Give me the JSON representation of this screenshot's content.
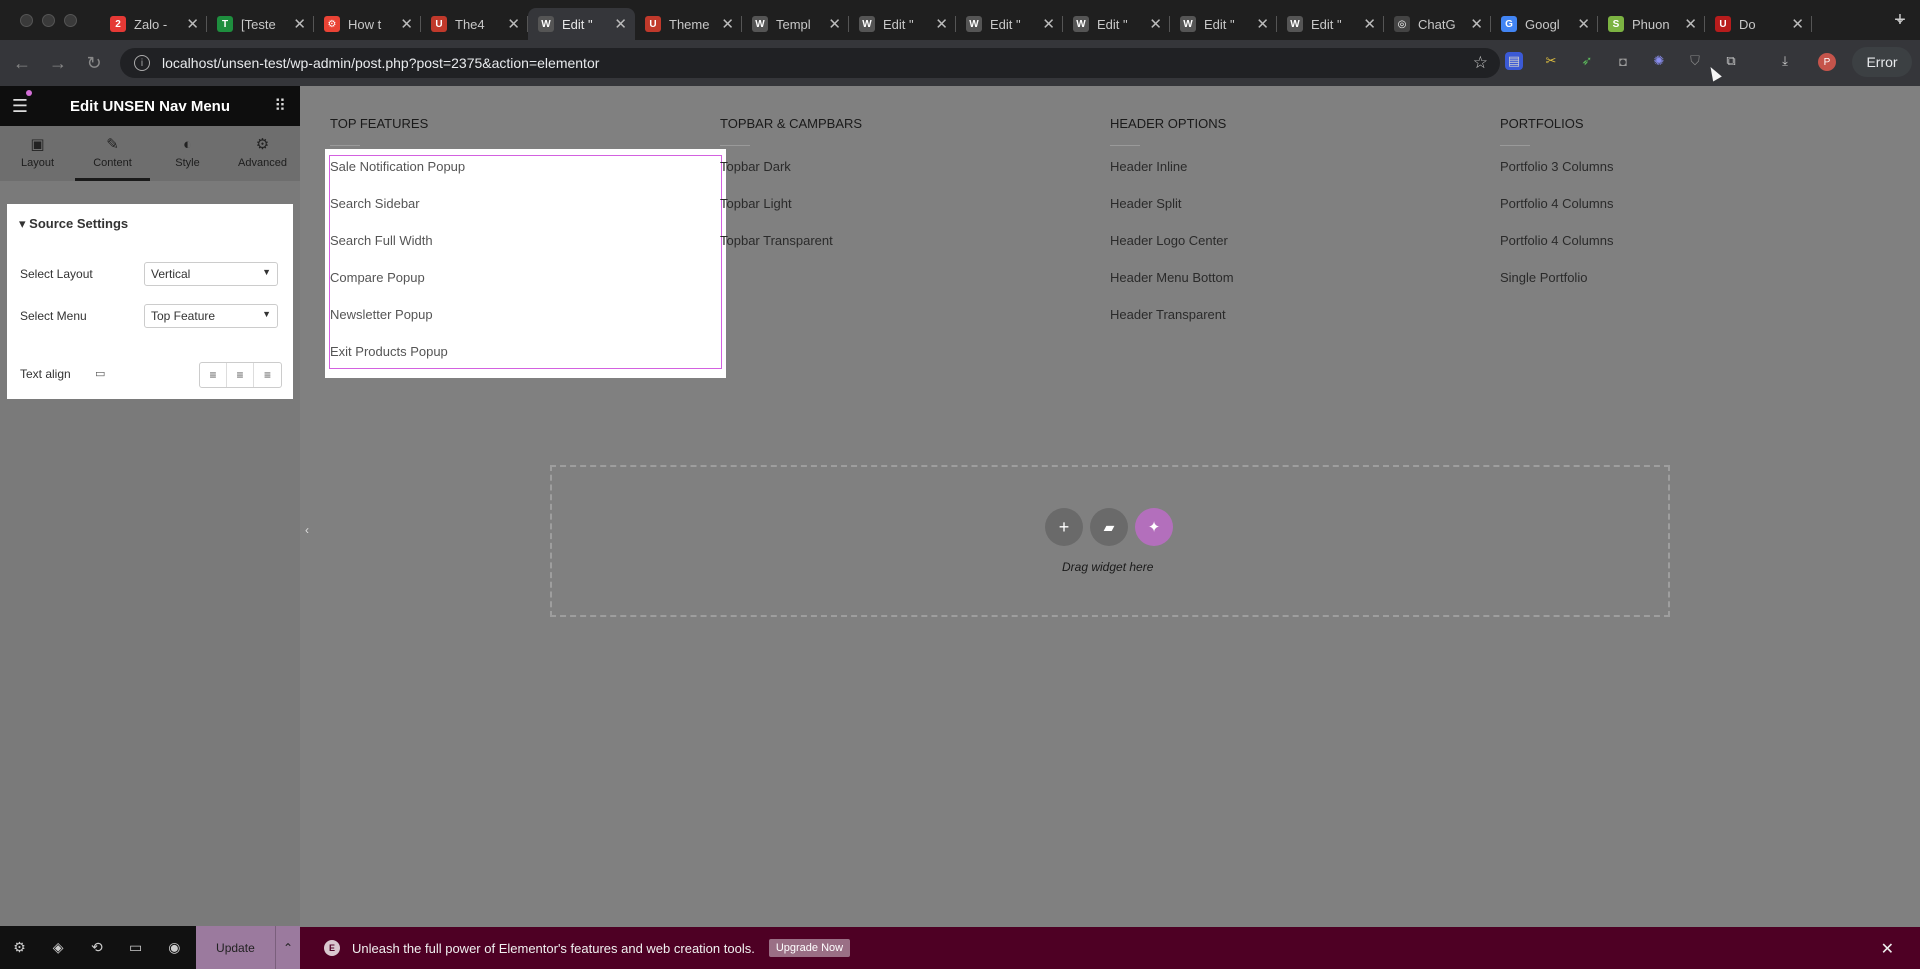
{
  "browser": {
    "tabs": [
      {
        "label": "Zalo -",
        "icon": "zalo-icon",
        "color": "#e53935",
        "glyph": "2"
      },
      {
        "label": "[Teste",
        "icon": "sheets-icon",
        "color": "#1e8e3e",
        "glyph": "T"
      },
      {
        "label": "How t",
        "icon": "colorful-icon",
        "color": "#ea4335",
        "glyph": "⚙"
      },
      {
        "label": "The4",
        "icon": "shopify-icon",
        "color": "#c0392b",
        "glyph": "U"
      },
      {
        "label": "Edit \"",
        "icon": "wordpress-icon",
        "color": "#555555",
        "glyph": "W"
      },
      {
        "label": "Theme",
        "icon": "shopify-icon",
        "color": "#c0392b",
        "glyph": "U"
      },
      {
        "label": "Templ",
        "icon": "wordpress-icon",
        "color": "#555555",
        "glyph": "W"
      },
      {
        "label": "Edit \"",
        "icon": "wordpress-icon",
        "color": "#555555",
        "glyph": "W"
      },
      {
        "label": "Edit \"",
        "icon": "wordpress-icon",
        "color": "#555555",
        "glyph": "W"
      },
      {
        "label": "Edit \"",
        "icon": "wordpress-icon",
        "color": "#555555",
        "glyph": "W"
      },
      {
        "label": "Edit \"",
        "icon": "wordpress-icon",
        "color": "#555555",
        "glyph": "W"
      },
      {
        "label": "Edit \"",
        "icon": "wordpress-icon",
        "color": "#555555",
        "glyph": "W"
      },
      {
        "label": "ChatG",
        "icon": "chatgpt-icon",
        "color": "#444444",
        "glyph": "◎"
      },
      {
        "label": "Googl",
        "icon": "google-translate-icon",
        "color": "#4285f4",
        "glyph": "G"
      },
      {
        "label": "Phuon",
        "icon": "shopify-icon",
        "color": "#7cb342",
        "glyph": "S"
      },
      {
        "label": "Do",
        "icon": "ublock-icon",
        "color": "#b71c1c",
        "glyph": "U"
      }
    ],
    "active_tab_index": 4,
    "url": "localhost/unsen-test/wp-admin/post.php?post=2375&action=elementor",
    "error_label": "Error",
    "profile_initial": "P"
  },
  "panel": {
    "title": "Edit UNSEN Nav Menu",
    "tabs": [
      {
        "label": "Layout",
        "icon": "layout-icon",
        "glyph": "▣"
      },
      {
        "label": "Content",
        "icon": "pencil-icon",
        "glyph": "✎"
      },
      {
        "label": "Style",
        "icon": "contrast-icon",
        "glyph": "◐"
      },
      {
        "label": "Advanced",
        "icon": "gear-icon",
        "glyph": "⚙"
      }
    ],
    "section_title": "Source Settings",
    "select_layout_label": "Select Layout",
    "select_layout_value": "Vertical",
    "select_menu_label": "Select Menu",
    "select_menu_value": "Top Feature",
    "text_align_label": "Text align",
    "update_label": "Update"
  },
  "menus": [
    {
      "heading": "TOP FEATURES",
      "items": [
        "Sale Notification Popup",
        "Search Sidebar",
        "Search Full Width",
        "Compare Popup",
        "Newsletter Popup",
        "Exit Products Popup"
      ]
    },
    {
      "heading": "TOPBAR & CAMPBARS",
      "items": [
        "Topbar Dark",
        "Topbar Light",
        "Topbar Transparent"
      ]
    },
    {
      "heading": "HEADER OPTIONS",
      "items": [
        "Header Inline",
        "Header Split",
        "Header Logo Center",
        "Header Menu Bottom",
        "Header Transparent"
      ]
    },
    {
      "heading": "PORTFOLIOS",
      "items": [
        "Portfolio 3 Columns",
        "Portfolio 4 Columns",
        "Portfolio 4 Columns",
        "Single Portfolio"
      ]
    }
  ],
  "dropzone": {
    "text": "Drag widget here"
  },
  "promo": {
    "text": "Unleash the full power of Elementor's features and web creation tools.",
    "button": "Upgrade Now"
  }
}
